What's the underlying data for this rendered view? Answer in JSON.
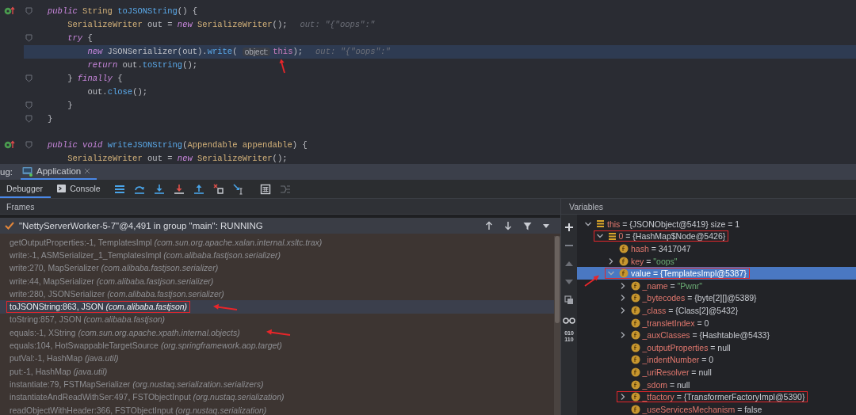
{
  "editor": {
    "lines": [
      {
        "override": true,
        "fold": true,
        "current": false,
        "tokens": [
          {
            "kind": "keyword",
            "text": "public"
          },
          {
            "kind": "type",
            "text": " String"
          },
          {
            "kind": "method",
            "text": " toJSONString"
          },
          {
            "kind": "plain",
            "text": "() {"
          }
        ]
      },
      {
        "override": false,
        "fold": false,
        "current": false,
        "tokens": [
          {
            "kind": "type",
            "text": "    SerializeWriter"
          },
          {
            "kind": "plain",
            "text": " out = "
          },
          {
            "kind": "keyword",
            "text": "new"
          },
          {
            "kind": "type",
            "text": " SerializeWriter"
          },
          {
            "kind": "plain",
            "text": "();"
          },
          {
            "kind": "hint",
            "text": "out: \"{\"oops\":\""
          }
        ]
      },
      {
        "override": false,
        "fold": true,
        "current": false,
        "tokens": [
          {
            "kind": "keyword",
            "text": "    try"
          },
          {
            "kind": "plain",
            "text": " {"
          }
        ]
      },
      {
        "override": false,
        "fold": false,
        "current": true,
        "tokens": [
          {
            "kind": "keyword",
            "text": "        new"
          },
          {
            "kind": "plain",
            "text": " JSONSerializer(out)."
          },
          {
            "kind": "method",
            "text": "write"
          },
          {
            "kind": "plain",
            "text": "( "
          },
          {
            "kind": "param",
            "text": "object:"
          },
          {
            "kind": "this",
            "text": "this",
            "arrow": true
          },
          {
            "kind": "plain",
            "text": ");"
          },
          {
            "kind": "hint",
            "text": "out: \"{\"oops\":\""
          }
        ]
      },
      {
        "override": false,
        "fold": false,
        "current": false,
        "tokens": [
          {
            "kind": "keyword",
            "text": "        return"
          },
          {
            "kind": "plain",
            "text": " out."
          },
          {
            "kind": "method",
            "text": "toString"
          },
          {
            "kind": "plain",
            "text": "();"
          }
        ]
      },
      {
        "override": false,
        "fold": true,
        "current": false,
        "tokens": [
          {
            "kind": "plain",
            "text": "    } "
          },
          {
            "kind": "keyword",
            "text": "finally"
          },
          {
            "kind": "plain",
            "text": " {"
          }
        ]
      },
      {
        "override": false,
        "fold": false,
        "current": false,
        "tokens": [
          {
            "kind": "plain",
            "text": "        out."
          },
          {
            "kind": "method",
            "text": "close"
          },
          {
            "kind": "plain",
            "text": "();"
          }
        ]
      },
      {
        "override": false,
        "fold": true,
        "current": false,
        "tokens": [
          {
            "kind": "plain",
            "text": "    }"
          }
        ]
      },
      {
        "override": false,
        "fold": true,
        "current": false,
        "tokens": [
          {
            "kind": "plain",
            "text": "}"
          }
        ]
      },
      {
        "override": false,
        "fold": false,
        "current": false
      },
      {
        "override": true,
        "fold": true,
        "current": false,
        "tokens": [
          {
            "kind": "keyword",
            "text": "public"
          },
          {
            "kind": "keyword",
            "text": " void"
          },
          {
            "kind": "method",
            "text": " writeJSONString"
          },
          {
            "kind": "plain",
            "text": "("
          },
          {
            "kind": "type",
            "text": "Appendable"
          },
          {
            "kind": "type",
            "text": " appendable"
          },
          {
            "kind": "plain",
            "text": ") {"
          }
        ]
      },
      {
        "override": false,
        "fold": false,
        "current": false,
        "tokens": [
          {
            "kind": "type",
            "text": "    SerializeWriter"
          },
          {
            "kind": "plain",
            "text": " out = "
          },
          {
            "kind": "keyword",
            "text": "new"
          },
          {
            "kind": "type",
            "text": " SerializeWriter"
          },
          {
            "kind": "plain",
            "text": "();"
          }
        ]
      }
    ]
  },
  "debug_bar": {
    "label": "ug:",
    "tabs": [
      {
        "label": "Application",
        "selected": true
      }
    ]
  },
  "toolbar": {
    "tabs": [
      {
        "label": "Debugger",
        "selected": true
      },
      {
        "label": "Console",
        "selected": false
      }
    ]
  },
  "frames": {
    "title": "Frames",
    "thread": "\"NettyServerWorker-5-7\"@4,491 in group \"main\": RUNNING",
    "items": [
      {
        "method": "getOutputProperties:-1, TemplatesImpl",
        "package": "(com.sun.org.apache.xalan.internal.xsltc.trax)",
        "selected": false,
        "boxed": false,
        "arrow": false
      },
      {
        "method": "write:-1, ASMSerializer_1_TemplatesImpl",
        "package": "(com.alibaba.fastjson.serializer)",
        "selected": false,
        "boxed": false,
        "arrow": false
      },
      {
        "method": "write:270, MapSerializer",
        "package": "(com.alibaba.fastjson.serializer)",
        "selected": false,
        "boxed": false,
        "arrow": false
      },
      {
        "method": "write:44, MapSerializer",
        "package": "(com.alibaba.fastjson.serializer)",
        "selected": false,
        "boxed": false,
        "arrow": false
      },
      {
        "method": "write:280, JSONSerializer",
        "package": "(com.alibaba.fastjson.serializer)",
        "selected": false,
        "boxed": false,
        "arrow": false
      },
      {
        "method": "toJSONString:863, JSON",
        "package": "(com.alibaba.fastjson)",
        "selected": true,
        "boxed": true,
        "arrow": true
      },
      {
        "method": "toString:857, JSON",
        "package": "(com.alibaba.fastjson)",
        "selected": false,
        "boxed": false,
        "arrow": false
      },
      {
        "method": "equals:-1, XString",
        "package": "(com.sun.org.apache.xpath.internal.objects)",
        "selected": false,
        "boxed": false,
        "arrow": true
      },
      {
        "method": "equals:104, HotSwappableTargetSource",
        "package": "(org.springframework.aop.target)",
        "selected": false,
        "boxed": false,
        "arrow": false
      },
      {
        "method": "putVal:-1, HashMap",
        "package": "(java.util)",
        "selected": false,
        "boxed": false,
        "arrow": false
      },
      {
        "method": "put:-1, HashMap",
        "package": "(java.util)",
        "selected": false,
        "boxed": false,
        "arrow": false
      },
      {
        "method": "instantiate:79, FSTMapSerializer",
        "package": "(org.nustaq.serialization.serializers)",
        "selected": false,
        "boxed": false,
        "arrow": false
      },
      {
        "method": "instantiateAndReadWithSer:497, FSTObjectInput",
        "package": "(org.nustaq.serialization)",
        "selected": false,
        "boxed": false,
        "arrow": false
      },
      {
        "method": "readObjectWithHeader:366, FSTObjectInput",
        "package": "(org.nustaq.serialization)",
        "selected": false,
        "boxed": false,
        "arrow": false
      }
    ]
  },
  "variables": {
    "title": "Variables",
    "side_label": "010 110",
    "tree": [
      {
        "name": "this",
        "sep": "=",
        "value": "{JSONObject@5419}",
        "extra": "size = 1",
        "kind": "array",
        "string_value": false,
        "expanded": true,
        "selected": false,
        "boxed": false,
        "arrow": false,
        "children": [
          {
            "name": "0",
            "sep": "=",
            "value": "{HashMap$Node@5426}",
            "kind": "array",
            "string_value": false,
            "expanded": true,
            "selected": false,
            "boxed": true,
            "arrow": false,
            "children": [
              {
                "name": "hash",
                "sep": "=",
                "value": "3417047",
                "kind": "field",
                "string_value": false,
                "selected": false,
                "boxed": false,
                "arrow": false
              },
              {
                "name": "key",
                "sep": "=",
                "value": "\"oops\"",
                "kind": "field",
                "string_value": true,
                "expanded": false,
                "selected": false,
                "boxed": false,
                "arrow": false
              },
              {
                "name": "value",
                "sep": "=",
                "value": "{TemplatesImpl@5387}",
                "kind": "field",
                "string_value": false,
                "expanded": true,
                "selected": true,
                "boxed": true,
                "arrow": true,
                "children": [
                  {
                    "name": "_name",
                    "sep": "=",
                    "value": "\"Pwnr\"",
                    "kind": "field",
                    "string_value": true,
                    "expanded": false,
                    "selected": false,
                    "boxed": false,
                    "arrow": false
                  },
                  {
                    "name": "_bytecodes",
                    "sep": "=",
                    "value": "{byte[2][]@5389}",
                    "kind": "field",
                    "string_value": false,
                    "expanded": false,
                    "selected": false,
                    "boxed": false,
                    "arrow": false
                  },
                  {
                    "name": "_class",
                    "sep": "=",
                    "value": "{Class[2]@5432}",
                    "kind": "field",
                    "string_value": false,
                    "expanded": false,
                    "selected": false,
                    "boxed": false,
                    "arrow": false
                  },
                  {
                    "name": "_transletIndex",
                    "sep": "=",
                    "value": "0",
                    "kind": "field",
                    "string_value": false,
                    "selected": false,
                    "boxed": false,
                    "arrow": false
                  },
                  {
                    "name": "_auxClasses",
                    "sep": "=",
                    "value": "{Hashtable@5433}",
                    "kind": "field",
                    "string_value": false,
                    "expanded": false,
                    "selected": false,
                    "boxed": false,
                    "arrow": false
                  },
                  {
                    "name": "_outputProperties",
                    "sep": "=",
                    "value": "null",
                    "kind": "field",
                    "string_value": false,
                    "selected": false,
                    "boxed": false,
                    "arrow": false
                  },
                  {
                    "name": "_indentNumber",
                    "sep": "=",
                    "value": "0",
                    "kind": "field",
                    "string_value": false,
                    "selected": false,
                    "boxed": false,
                    "arrow": false
                  },
                  {
                    "name": "_uriResolver",
                    "sep": "=",
                    "value": "null",
                    "kind": "field",
                    "string_value": false,
                    "selected": false,
                    "boxed": false,
                    "arrow": false
                  },
                  {
                    "name": "_sdom",
                    "sep": "=",
                    "value": "null",
                    "kind": "field",
                    "string_value": false,
                    "selected": false,
                    "boxed": false,
                    "arrow": false
                  },
                  {
                    "name": "_tfactory",
                    "sep": "=",
                    "value": "{TransformerFactoryImpl@5390}",
                    "kind": "field",
                    "string_value": false,
                    "expanded": false,
                    "selected": false,
                    "boxed": true,
                    "arrow": false
                  },
                  {
                    "name": "_useServicesMechanism",
                    "sep": "=",
                    "value": "false",
                    "kind": "field",
                    "string_value": false,
                    "selected": false,
                    "boxed": false,
                    "arrow": false
                  }
                ]
              }
            ]
          }
        ]
      }
    ]
  }
}
